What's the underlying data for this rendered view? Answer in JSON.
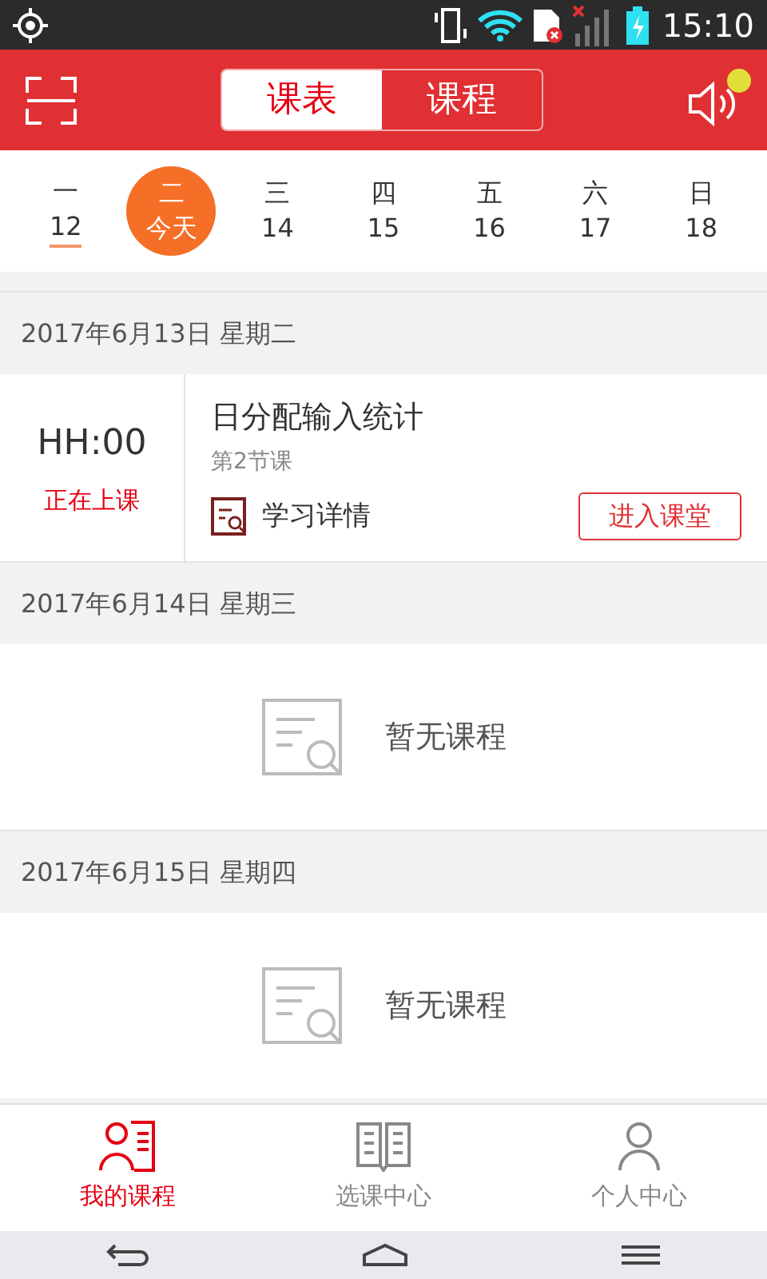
{
  "status_bar": {
    "time": "15:10"
  },
  "header": {
    "tabs": [
      {
        "label": "课表",
        "selected": true
      },
      {
        "label": "课程",
        "selected": false
      }
    ],
    "notification_dot": true
  },
  "week": [
    {
      "weekday": "一",
      "date": "12",
      "selected": false,
      "underlined": true
    },
    {
      "weekday": "二",
      "date": "今天",
      "selected": true,
      "underlined": false
    },
    {
      "weekday": "三",
      "date": "14",
      "selected": false,
      "underlined": false
    },
    {
      "weekday": "四",
      "date": "15",
      "selected": false,
      "underlined": false
    },
    {
      "weekday": "五",
      "date": "16",
      "selected": false,
      "underlined": false
    },
    {
      "weekday": "六",
      "date": "17",
      "selected": false,
      "underlined": false
    },
    {
      "weekday": "日",
      "date": "18",
      "selected": false,
      "underlined": false
    }
  ],
  "days": [
    {
      "date": "2017年6月13日 星期二",
      "kind": "class",
      "time": "HH:00",
      "status": "正在上课",
      "title": "日分配输入统计",
      "period": "第2节课",
      "details": "学习详情",
      "button": "进入课堂"
    },
    {
      "date": "2017年6月14日 星期三",
      "kind": "empty",
      "message": "暂无课程"
    },
    {
      "date": "2017年6月15日 星期四",
      "kind": "empty",
      "message": "暂无课程"
    }
  ],
  "tab_bar": [
    {
      "label": "我的课程",
      "selected": true
    },
    {
      "label": "选课中心",
      "selected": false
    },
    {
      "label": "个人中心",
      "selected": false
    }
  ]
}
